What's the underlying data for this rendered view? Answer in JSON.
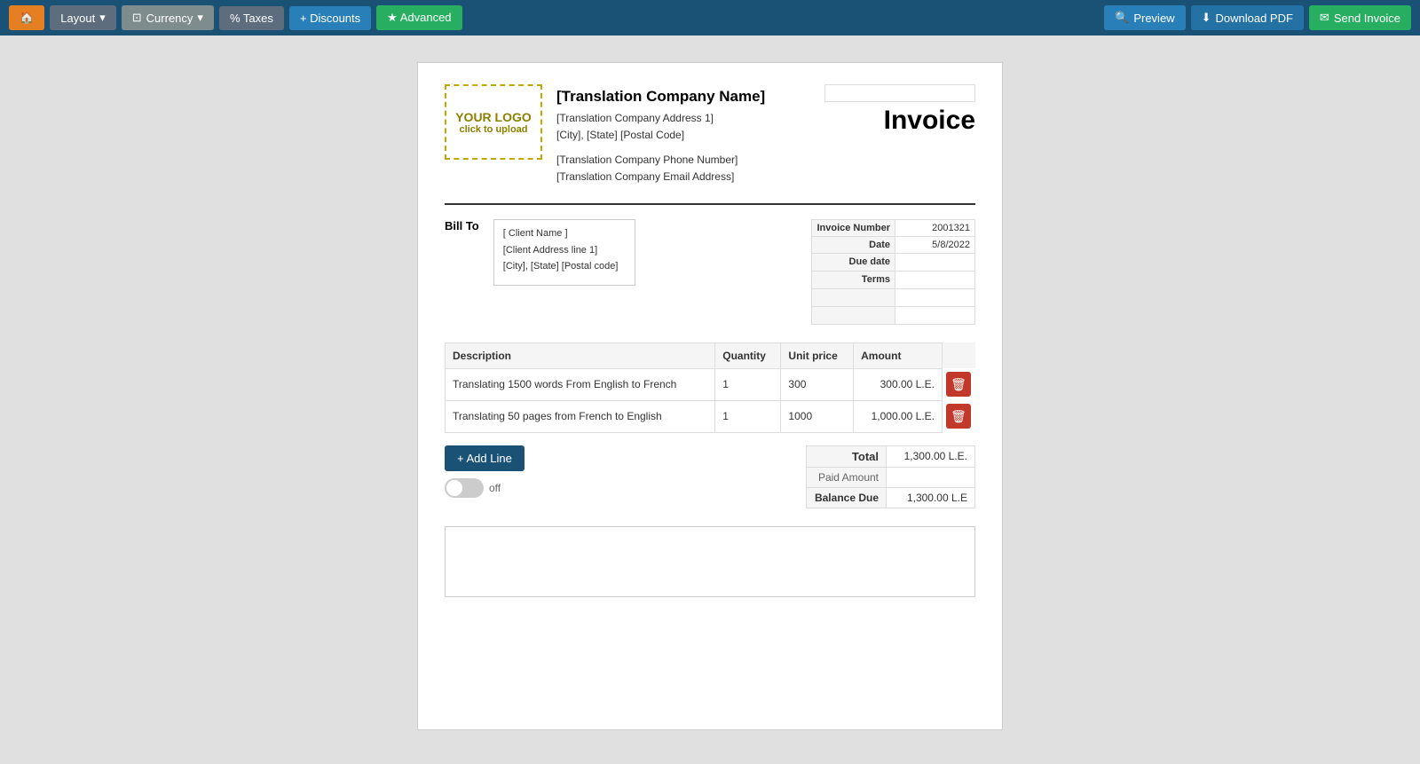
{
  "toolbar": {
    "home_icon": "🏠",
    "layout_label": "Layout",
    "currency_label": "Currency",
    "taxes_label": "% Taxes",
    "discounts_label": "+ Discounts",
    "advanced_label": "★ Advanced",
    "preview_label": "Preview",
    "download_label": "Download PDF",
    "send_label": "Send Invoice"
  },
  "invoice": {
    "logo_text": "YOUR LOGO",
    "logo_subtext": "click to upload",
    "company_name": "[Translation Company Name]",
    "company_address1": "[Translation Company Address 1]",
    "company_city": "[City], [State] [Postal Code]",
    "company_phone": "[Translation Company Phone Number]",
    "company_email": "[Translation Company Email Address]",
    "title": "Invoice",
    "bill_to_label": "Bill To",
    "client_name": "[ Client Name ]",
    "client_address": "[Client Address line 1]",
    "client_city": "[City], [State] [Postal code]",
    "invoice_number_label": "Invoice Number",
    "invoice_number_value": "2001321",
    "date_label": "Date",
    "date_value": "5/8/2022",
    "due_date_label": "Due date",
    "due_date_value": "",
    "terms_label": "Terms",
    "terms_value": "",
    "extra_row1_label": "",
    "extra_row1_value": "",
    "extra_row2_label": "",
    "extra_row2_value": "",
    "table_headers": {
      "description": "Description",
      "quantity": "Quantity",
      "unit_price": "Unit price",
      "amount": "Amount"
    },
    "line_items": [
      {
        "description": "Translating 1500 words From English to French",
        "quantity": "1",
        "unit_price": "300",
        "amount": "300.00 L.E."
      },
      {
        "description": "Translating 50 pages from French to English",
        "quantity": "1",
        "unit_price": "1000",
        "amount": "1,000.00 L.E."
      }
    ],
    "add_line_label": "+ Add Line",
    "toggle_label": "off",
    "total_label": "Total",
    "total_value": "1,300.00 L.E.",
    "paid_amount_label": "Paid Amount",
    "paid_amount_value": "",
    "balance_due_label": "Balance Due",
    "balance_due_value": "1,300.00 L.E"
  }
}
